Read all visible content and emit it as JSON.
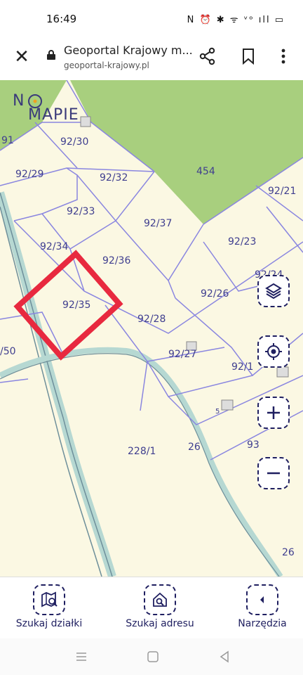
{
  "status": {
    "time": "16:49",
    "icons": "N ⏰ ✱ ᯤ ᵛᵒ ıll ▭"
  },
  "browser": {
    "close": "✕",
    "title": "Geoportal Krajowy m...",
    "url": "geoportal-krajowy.pl"
  },
  "map": {
    "logo_n": "N",
    "logo_mapie": "MAPIE",
    "parcels": [
      "91",
      "92/30",
      "92/29",
      "92/32",
      "454",
      "92/21",
      "92/33",
      "92/37",
      "92/34",
      "92/23",
      "92/36",
      "92/24",
      "92/35",
      "92/26",
      "92/28",
      "/50",
      "92/27",
      "92/1",
      "5",
      "26",
      "93",
      "228/1",
      "26"
    ]
  },
  "bottom_nav": {
    "search_parcel": "Szukaj działki",
    "search_address": "Szukaj adresu",
    "tools": "Narzędzia"
  },
  "colors": {
    "map_bg": "#fbf8e3",
    "green_area": "#a8cf7e",
    "parcel_line": "#8a86e0",
    "highlight": "#e8293f",
    "accent": "#1f1f60"
  }
}
